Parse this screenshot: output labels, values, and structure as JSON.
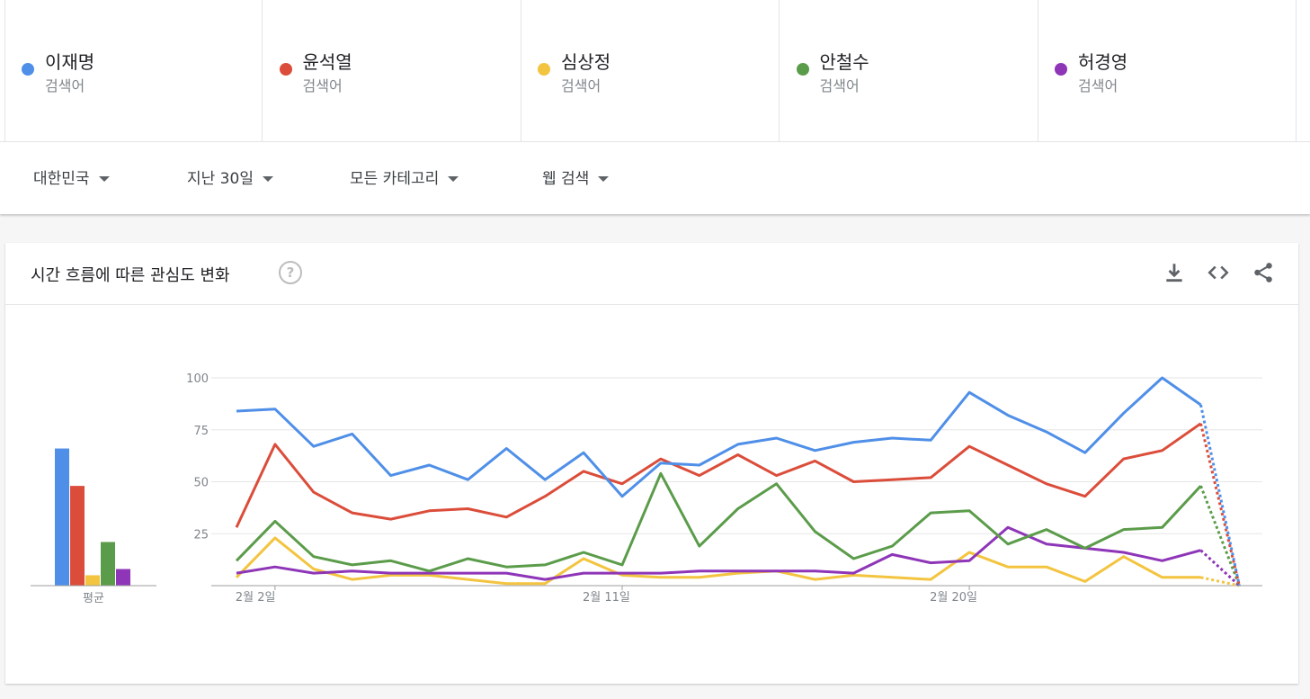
{
  "terms": [
    {
      "name": "이재명",
      "type": "검색어",
      "color": "#4f8fe8"
    },
    {
      "name": "윤석열",
      "type": "검색어",
      "color": "#db4d3a"
    },
    {
      "name": "심상정",
      "type": "검색어",
      "color": "#f3c43f"
    },
    {
      "name": "안철수",
      "type": "검색어",
      "color": "#5b9c4a"
    },
    {
      "name": "허경영",
      "type": "검색어",
      "color": "#8e35b8"
    }
  ],
  "filters": {
    "region": "대한민국",
    "period": "지난 30일",
    "category": "모든 카테고리",
    "search_type": "웹 검색"
  },
  "card": {
    "title": "시간 흐름에 따른 관심도 변화",
    "help_icon": "?",
    "tools": [
      "download-icon",
      "embed-code-icon",
      "share-icon"
    ]
  },
  "chart_data": {
    "type": "line",
    "y_ticks": [
      100,
      75,
      50,
      25
    ],
    "ylim": [
      0,
      100
    ],
    "x_tick_labels": [
      {
        "label": "2월 2일",
        "index": 1
      },
      {
        "label": "2월 11일",
        "index": 10
      },
      {
        "label": "2월 20일",
        "index": 19
      }
    ],
    "n_points": 28,
    "partial_from_index": 26,
    "series": [
      {
        "name": "이재명",
        "color": "#4f8fe8",
        "average": 66,
        "values": [
          84,
          85,
          67,
          73,
          53,
          58,
          51,
          66,
          51,
          64,
          43,
          59,
          58,
          68,
          71,
          65,
          69,
          71,
          70,
          93,
          82,
          74,
          64,
          83,
          100,
          87,
          0
        ]
      },
      {
        "name": "윤석열",
        "color": "#db4d3a",
        "average": 48,
        "values": [
          28,
          68,
          45,
          35,
          32,
          36,
          37,
          33,
          43,
          55,
          49,
          61,
          53,
          63,
          53,
          60,
          50,
          51,
          52,
          67,
          58,
          49,
          43,
          61,
          65,
          78,
          0
        ]
      },
      {
        "name": "심상정",
        "color": "#f3c43f",
        "average": 5,
        "values": [
          4,
          23,
          8,
          3,
          5,
          5,
          3,
          1,
          1,
          13,
          5,
          4,
          4,
          6,
          7,
          3,
          5,
          4,
          3,
          16,
          9,
          9,
          2,
          14,
          4,
          4,
          0
        ]
      },
      {
        "name": "안철수",
        "color": "#5b9c4a",
        "average": 21,
        "values": [
          12,
          31,
          14,
          10,
          12,
          7,
          13,
          9,
          10,
          16,
          10,
          54,
          19,
          37,
          49,
          26,
          13,
          19,
          35,
          36,
          20,
          27,
          18,
          27,
          28,
          48,
          0
        ]
      },
      {
        "name": "허경영",
        "color": "#8e35b8",
        "average": 8,
        "values": [
          6,
          9,
          6,
          7,
          6,
          6,
          6,
          6,
          3,
          6,
          6,
          6,
          7,
          7,
          7,
          7,
          6,
          15,
          11,
          12,
          28,
          20,
          18,
          16,
          12,
          17,
          0
        ]
      }
    ],
    "average_label": "평균"
  }
}
